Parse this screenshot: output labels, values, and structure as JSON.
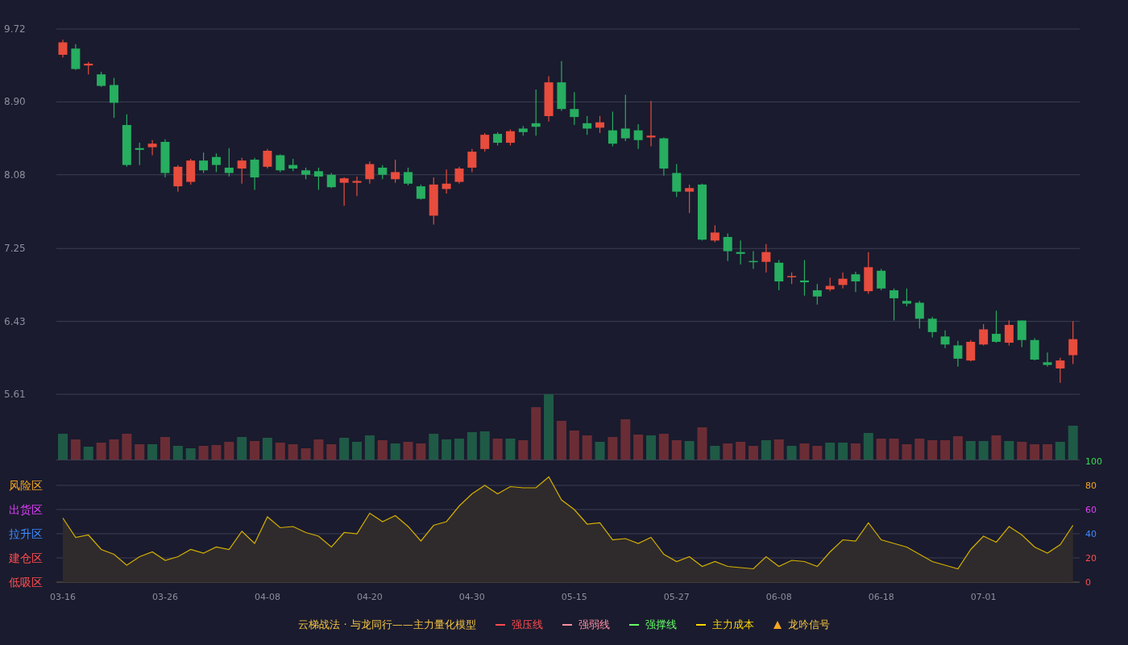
{
  "price_chart": {
    "chart_data": {
      "type": "candlestick",
      "grid": true,
      "ylim": [
        5.61,
        9.72
      ],
      "yticks": [
        {
          "value": 9.72,
          "label": "9.72"
        },
        {
          "value": 8.9,
          "label": "8.90"
        },
        {
          "value": 8.08,
          "label": "8.08"
        },
        {
          "value": 7.25,
          "label": "7.25"
        },
        {
          "value": 6.43,
          "label": "6.43"
        },
        {
          "value": 5.61,
          "label": "5.61"
        }
      ],
      "ohlc": [
        [
          9.43,
          9.6,
          9.4,
          9.57
        ],
        [
          9.5,
          9.55,
          9.26,
          9.27
        ],
        [
          9.31,
          9.35,
          9.21,
          9.33
        ],
        [
          9.21,
          9.24,
          9.07,
          9.08
        ],
        [
          9.09,
          9.17,
          8.72,
          8.89
        ],
        [
          8.64,
          8.76,
          8.17,
          8.19
        ],
        [
          8.38,
          8.44,
          8.19,
          8.36
        ],
        [
          8.39,
          8.47,
          8.3,
          8.43
        ],
        [
          8.45,
          8.48,
          8.05,
          8.1
        ],
        [
          7.95,
          8.19,
          7.89,
          8.17
        ],
        [
          8.0,
          8.26,
          7.97,
          8.24
        ],
        [
          8.24,
          8.33,
          8.1,
          8.13
        ],
        [
          8.28,
          8.32,
          8.11,
          8.19
        ],
        [
          8.16,
          8.38,
          8.06,
          8.1
        ],
        [
          8.15,
          8.27,
          7.98,
          8.24
        ],
        [
          8.25,
          8.27,
          7.91,
          8.05
        ],
        [
          8.17,
          8.37,
          8.15,
          8.35
        ],
        [
          8.3,
          8.31,
          8.11,
          8.13
        ],
        [
          8.19,
          8.26,
          8.12,
          8.15
        ],
        [
          8.13,
          8.16,
          8.03,
          8.08
        ],
        [
          8.12,
          8.16,
          7.91,
          8.06
        ],
        [
          8.08,
          8.1,
          7.93,
          7.94
        ],
        [
          7.99,
          8.05,
          7.73,
          8.04
        ],
        [
          7.99,
          8.06,
          7.84,
          8.01
        ],
        [
          8.03,
          8.23,
          7.98,
          8.2
        ],
        [
          8.16,
          8.19,
          8.03,
          8.08
        ],
        [
          8.03,
          8.25,
          7.99,
          8.11
        ],
        [
          8.11,
          8.16,
          7.96,
          7.98
        ],
        [
          7.95,
          7.97,
          7.8,
          7.81
        ],
        [
          7.62,
          8.05,
          7.52,
          7.97
        ],
        [
          7.92,
          8.14,
          7.87,
          7.98
        ],
        [
          8.0,
          8.17,
          7.98,
          8.15
        ],
        [
          8.16,
          8.37,
          8.11,
          8.34
        ],
        [
          8.37,
          8.55,
          8.34,
          8.53
        ],
        [
          8.54,
          8.56,
          8.41,
          8.44
        ],
        [
          8.44,
          8.59,
          8.41,
          8.57
        ],
        [
          8.6,
          8.63,
          8.52,
          8.56
        ],
        [
          8.66,
          9.04,
          8.52,
          8.62
        ],
        [
          8.74,
          9.19,
          8.68,
          9.12
        ],
        [
          9.12,
          9.36,
          8.8,
          8.82
        ],
        [
          8.82,
          9.01,
          8.64,
          8.73
        ],
        [
          8.66,
          8.74,
          8.53,
          8.6
        ],
        [
          8.61,
          8.74,
          8.55,
          8.67
        ],
        [
          8.58,
          8.79,
          8.4,
          8.43
        ],
        [
          8.6,
          8.98,
          8.46,
          8.49
        ],
        [
          8.58,
          8.65,
          8.37,
          8.47
        ],
        [
          8.5,
          8.91,
          8.4,
          8.52
        ],
        [
          8.49,
          8.5,
          8.07,
          8.15
        ],
        [
          8.1,
          8.2,
          7.83,
          7.89
        ],
        [
          7.89,
          7.97,
          7.65,
          7.93
        ],
        [
          7.97,
          7.98,
          7.34,
          7.35
        ],
        [
          7.34,
          7.51,
          7.32,
          7.43
        ],
        [
          7.38,
          7.42,
          7.11,
          7.22
        ],
        [
          7.21,
          7.34,
          7.07,
          7.19
        ],
        [
          7.11,
          7.22,
          7.02,
          7.1
        ],
        [
          7.1,
          7.3,
          6.98,
          7.21
        ],
        [
          7.09,
          7.12,
          6.78,
          6.88
        ],
        [
          6.93,
          6.98,
          6.85,
          6.94
        ],
        [
          6.89,
          7.12,
          6.72,
          6.87
        ],
        [
          6.78,
          6.85,
          6.62,
          6.71
        ],
        [
          6.79,
          6.92,
          6.77,
          6.83
        ],
        [
          6.84,
          6.98,
          6.8,
          6.91
        ],
        [
          6.96,
          6.99,
          6.76,
          6.88
        ],
        [
          6.77,
          7.21,
          6.74,
          7.04
        ],
        [
          7.0,
          7.02,
          6.78,
          6.8
        ],
        [
          6.78,
          6.8,
          6.44,
          6.69
        ],
        [
          6.66,
          6.8,
          6.6,
          6.63
        ],
        [
          6.64,
          6.66,
          6.35,
          6.46
        ],
        [
          6.46,
          6.48,
          6.25,
          6.31
        ],
        [
          6.26,
          6.33,
          6.13,
          6.17
        ],
        [
          6.16,
          6.21,
          5.92,
          6.01
        ],
        [
          5.99,
          6.22,
          5.98,
          6.2
        ],
        [
          6.17,
          6.4,
          6.16,
          6.34
        ],
        [
          6.29,
          6.55,
          6.19,
          6.2
        ],
        [
          6.19,
          6.44,
          6.16,
          6.39
        ],
        [
          6.44,
          6.44,
          6.14,
          6.22
        ],
        [
          6.22,
          6.24,
          5.99,
          6.0
        ],
        [
          5.97,
          6.08,
          5.92,
          5.94
        ],
        [
          5.9,
          6.02,
          5.74,
          5.99
        ],
        [
          6.05,
          6.43,
          5.95,
          6.23
        ]
      ]
    }
  },
  "indicator_chart": {
    "zones": [
      {
        "label": "风险区",
        "color": "#f5a623"
      },
      {
        "label": "出货区",
        "color": "#e040fb"
      },
      {
        "label": "拉升区",
        "color": "#3d8bff"
      },
      {
        "label": "建仓区",
        "color": "#ff4d4f"
      },
      {
        "label": "低吸区",
        "color": "#ff4d4f"
      }
    ],
    "tick_styles": [
      {
        "color": "#ff4d4f"
      },
      {
        "color": "#ff4d4f"
      },
      {
        "color": "#3d8bff"
      },
      {
        "color": "#e040fb"
      },
      {
        "color": "#f5a623"
      },
      {
        "color": "#33dd55"
      }
    ],
    "chart_data": {
      "type": "area",
      "grid": true,
      "ylim": [
        0,
        100
      ],
      "yticks": [
        0,
        20,
        40,
        60,
        80,
        100
      ],
      "categories": [
        "03-16",
        null,
        null,
        null,
        null,
        null,
        null,
        null,
        "03-26",
        null,
        null,
        null,
        null,
        null,
        null,
        null,
        "04-08",
        null,
        null,
        null,
        null,
        null,
        null,
        null,
        "04-20",
        null,
        null,
        null,
        null,
        null,
        null,
        null,
        "04-30",
        null,
        null,
        null,
        null,
        null,
        null,
        null,
        "05-15",
        null,
        null,
        null,
        null,
        null,
        null,
        null,
        "05-27",
        null,
        null,
        null,
        null,
        null,
        null,
        null,
        "06-08",
        null,
        null,
        null,
        null,
        null,
        null,
        null,
        "06-18",
        null,
        null,
        null,
        null,
        null,
        null,
        null,
        "07-01",
        null,
        null,
        null,
        null,
        null,
        null,
        null
      ],
      "series": [
        {
          "color": "#d4b000",
          "values": [
            53,
            37,
            39,
            27,
            23,
            14,
            21,
            25,
            18,
            21,
            27,
            24,
            29,
            27,
            42,
            32,
            54,
            45,
            46,
            41,
            38,
            29,
            41,
            40,
            57,
            50,
            55,
            46,
            34,
            47,
            50,
            63,
            73,
            80,
            73,
            79,
            78,
            78,
            87,
            68,
            60,
            48,
            49,
            35,
            36,
            32,
            37,
            23,
            17,
            21,
            13,
            17,
            13,
            12,
            11,
            21,
            13,
            18,
            17,
            13,
            25,
            35,
            34,
            49,
            35,
            32,
            29,
            23,
            17,
            14,
            11,
            27,
            38,
            33,
            46,
            39,
            29,
            24,
            31,
            47
          ]
        }
      ]
    }
  },
  "legend": {
    "title": "云梯战法 · 与龙同行——主力量化模型",
    "items": [
      {
        "label": "强压线",
        "kind": "solid",
        "color": "#ff4d4f"
      },
      {
        "label": "强弱线",
        "kind": "dashed",
        "color": "#ff8fa3"
      },
      {
        "label": "强撑线",
        "kind": "solid",
        "color": "#66ff66"
      },
      {
        "label": "主力成本",
        "kind": "dashed",
        "color": "#ffd700"
      },
      {
        "label": "龙吟信号",
        "kind": "triangle",
        "color": "#f5a623"
      }
    ]
  }
}
